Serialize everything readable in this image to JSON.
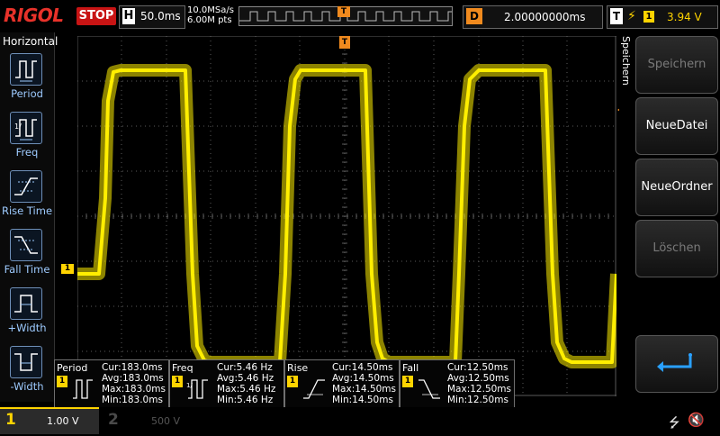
{
  "header": {
    "logo": "RIGOL",
    "run_state": "STOP",
    "timebase_label": "H",
    "timebase_value": "50.0ms",
    "sample_rate": "10.0MSa/s",
    "memory_depth": "6.00M pts",
    "trigger_marker": "T",
    "delay_label": "D",
    "delay_value": "2.00000000ms",
    "trigger_label": "T",
    "trigger_edge_icon": "rising-edge-icon",
    "trigger_channel": "1",
    "trigger_level": "3.94 V"
  },
  "left_menu": {
    "title": "Horizontal",
    "items": [
      {
        "label": "Period",
        "icon": "period-icon"
      },
      {
        "label": "Freq",
        "icon": "freq-icon"
      },
      {
        "label": "Rise Time",
        "icon": "rise-time-icon"
      },
      {
        "label": "Fall Time",
        "icon": "fall-time-icon"
      },
      {
        "label": "+Width",
        "icon": "pos-width-icon"
      },
      {
        "label": "-Width",
        "icon": "neg-width-icon"
      }
    ]
  },
  "plot": {
    "channel_marker": "1",
    "trigger_marker": "T",
    "trace_color": "#ffee00",
    "grid_color": "#5a5a5a"
  },
  "chart_data": {
    "type": "line",
    "series": [
      {
        "x": [
          0,
          24,
          31,
          34,
          40,
          48,
          120,
          128,
          133,
          141,
          148,
          225,
          231,
          236,
          242,
          248,
          320,
          327,
          333,
          339,
          346,
          420,
          424,
          430,
          436,
          446,
          520,
          528,
          533,
          541,
          549,
          594,
          599
        ],
        "y": [
          66,
          66,
          45,
          18,
          10,
          9.5,
          9.5,
          66,
          86,
          90,
          90.5,
          90.5,
          66,
          25,
          12,
          9.5,
          9.5,
          66,
          85,
          89.5,
          90.5,
          90.5,
          66,
          25,
          12,
          9.5,
          9.5,
          66,
          85,
          89.5,
          90.5,
          90.5,
          66
        ]
      }
    ]
  },
  "measurements": [
    {
      "name": "Period",
      "channel": "1",
      "icon": "period-icon",
      "cur": "Cur:183.0ms",
      "avg": "Avg:183.0ms",
      "max": "Max:183.0ms",
      "min": "Min:183.0ms"
    },
    {
      "name": "Freq",
      "channel": "1",
      "icon": "freq-icon",
      "cur": "Cur:5.46 Hz",
      "avg": "Avg:5.46 Hz",
      "max": "Max:5.46 Hz",
      "min": "Min:5.46 Hz"
    },
    {
      "name": "Rise",
      "channel": "1",
      "icon": "rise-time-icon",
      "cur": "Cur:14.50ms",
      "avg": "Avg:14.50ms",
      "max": "Max:14.50ms",
      "min": "Min:14.50ms"
    },
    {
      "name": "Fall",
      "channel": "1",
      "icon": "fall-time-icon",
      "cur": "Cur:12.50ms",
      "avg": "Avg:12.50ms",
      "max": "Max:12.50ms",
      "min": "Min:12.50ms"
    }
  ],
  "right_menu": {
    "title": "Speichern",
    "softkeys": [
      {
        "label": "Speichern",
        "enabled": false
      },
      {
        "label": "NeueDatei",
        "enabled": true
      },
      {
        "label": "NeueOrdner",
        "enabled": true
      },
      {
        "label": "Löschen",
        "enabled": false
      },
      {
        "label": "",
        "enabled": true,
        "icon": "enter-return-icon"
      }
    ]
  },
  "footer": {
    "ch1_number": "1",
    "ch1_scale": "1.00 V",
    "ch2_number": "2",
    "ch2_scale": "500 V",
    "usb_icon": "usb-icon",
    "mute_icon": "speaker-mute-icon"
  }
}
